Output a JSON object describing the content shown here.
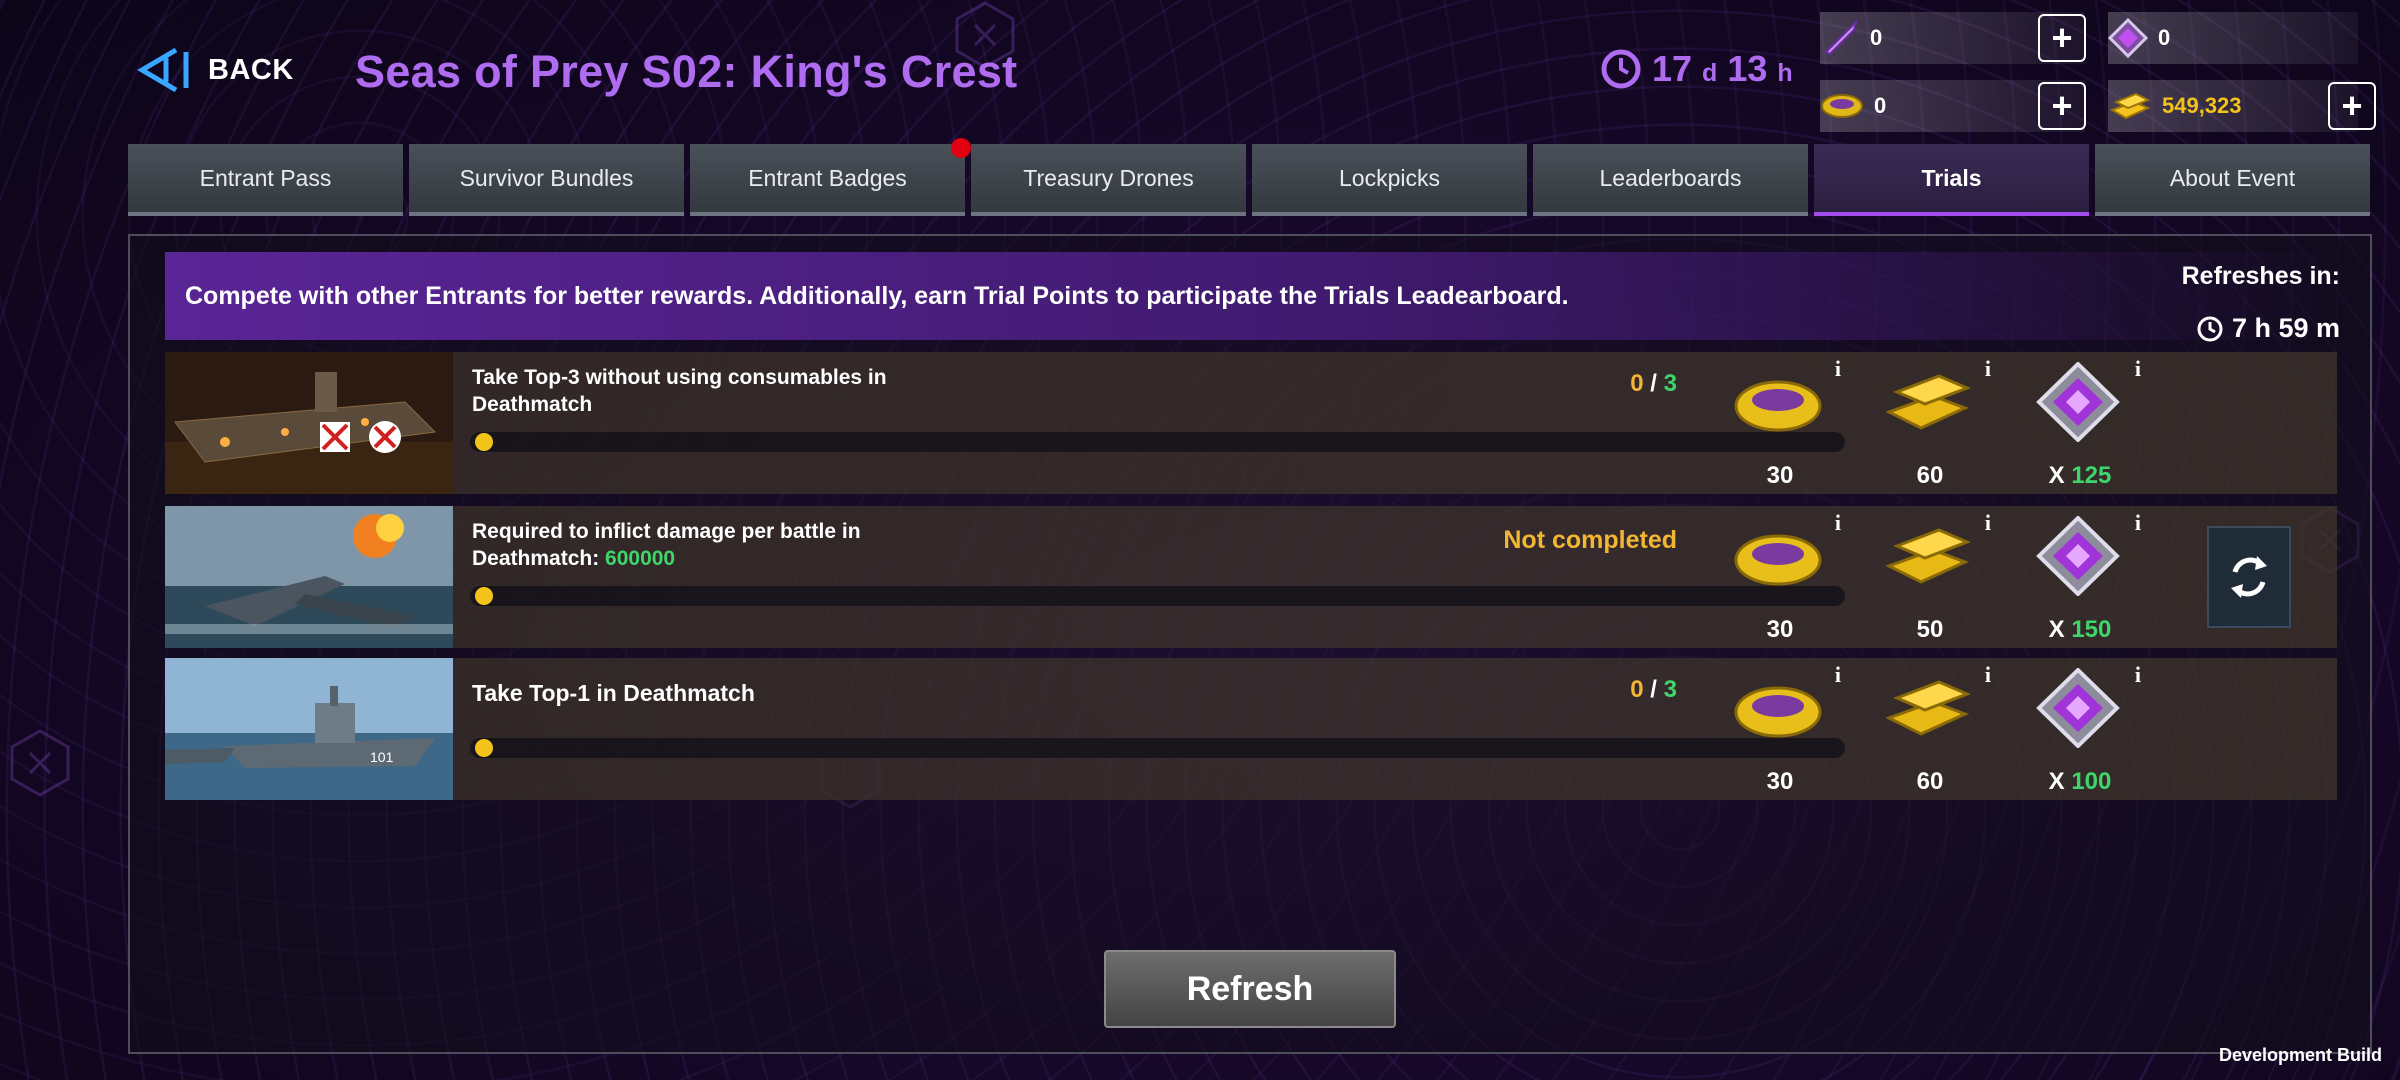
{
  "header": {
    "back_label": "BACK",
    "title": "Seas of Prey S02: King's Crest",
    "timer": {
      "days": "17",
      "days_unit": "d",
      "hours": "13",
      "hours_unit": "h"
    }
  },
  "resources": [
    {
      "icon": "rocket-ammo-icon",
      "value": "0",
      "has_plus": true
    },
    {
      "icon": "purple-crest-icon",
      "value": "0",
      "has_plus": false
    },
    {
      "icon": "drone-token-icon",
      "value": "0",
      "has_plus": true
    },
    {
      "icon": "gold-bars-icon",
      "value": "549,323",
      "has_plus": true
    }
  ],
  "tabs": [
    {
      "label": "Entrant Pass",
      "active": false,
      "badge": false
    },
    {
      "label": "Survivor Bundles",
      "active": false,
      "badge": false
    },
    {
      "label": "Entrant Badges",
      "active": false,
      "badge": true
    },
    {
      "label": "Treasury Drones",
      "active": false,
      "badge": false
    },
    {
      "label": "Lockpicks",
      "active": false,
      "badge": false
    },
    {
      "label": "Leaderboards",
      "active": false,
      "badge": false
    },
    {
      "label": "Trials",
      "active": true,
      "badge": false
    },
    {
      "label": "About Event",
      "active": false,
      "badge": false
    }
  ],
  "banner": {
    "text": "Compete with other Entrants for better rewards. Additionally, earn Trial Points to participate the Trials Leadearboard.",
    "refresh_label": "Refreshes in:",
    "refresh_time": "7 h 59 m"
  },
  "trials": [
    {
      "task": "Take Top-3 without using consumables in Deathmatch",
      "progress_current": "0",
      "progress_sep": " / ",
      "progress_max": "3",
      "progress": 0,
      "rewards": [
        {
          "icon": "drone-token-icon",
          "amount": "30"
        },
        {
          "icon": "gold-bars-icon",
          "amount": "60"
        },
        {
          "icon": "purple-crest-icon",
          "prefix": "X ",
          "amount": "125"
        }
      ]
    },
    {
      "task": "Required to inflict damage per battle in Deathmatch: ",
      "task_highlight": "600000",
      "status": "Not completed",
      "progress": 0,
      "rewards": [
        {
          "icon": "drone-token-icon",
          "amount": "30"
        },
        {
          "icon": "gold-bars-icon",
          "amount": "50"
        },
        {
          "icon": "purple-crest-icon",
          "prefix": "X ",
          "amount": "150"
        }
      ]
    },
    {
      "task": "Take Top-1 in Deathmatch",
      "progress_current": "0",
      "progress_sep": " / ",
      "progress_max": "3",
      "progress": 0,
      "rewards": [
        {
          "icon": "drone-token-icon",
          "amount": "30"
        },
        {
          "icon": "gold-bars-icon",
          "amount": "60"
        },
        {
          "icon": "purple-crest-icon",
          "prefix": "X ",
          "amount": "100"
        }
      ]
    }
  ],
  "info_glyph": "i",
  "refresh_button": "Refresh",
  "footer": "Development Build",
  "colors": {
    "accent_purple": "#b06cf0",
    "progress_yellow": "#f2b632",
    "green": "#3ed66b",
    "badge_red": "#e00010"
  }
}
